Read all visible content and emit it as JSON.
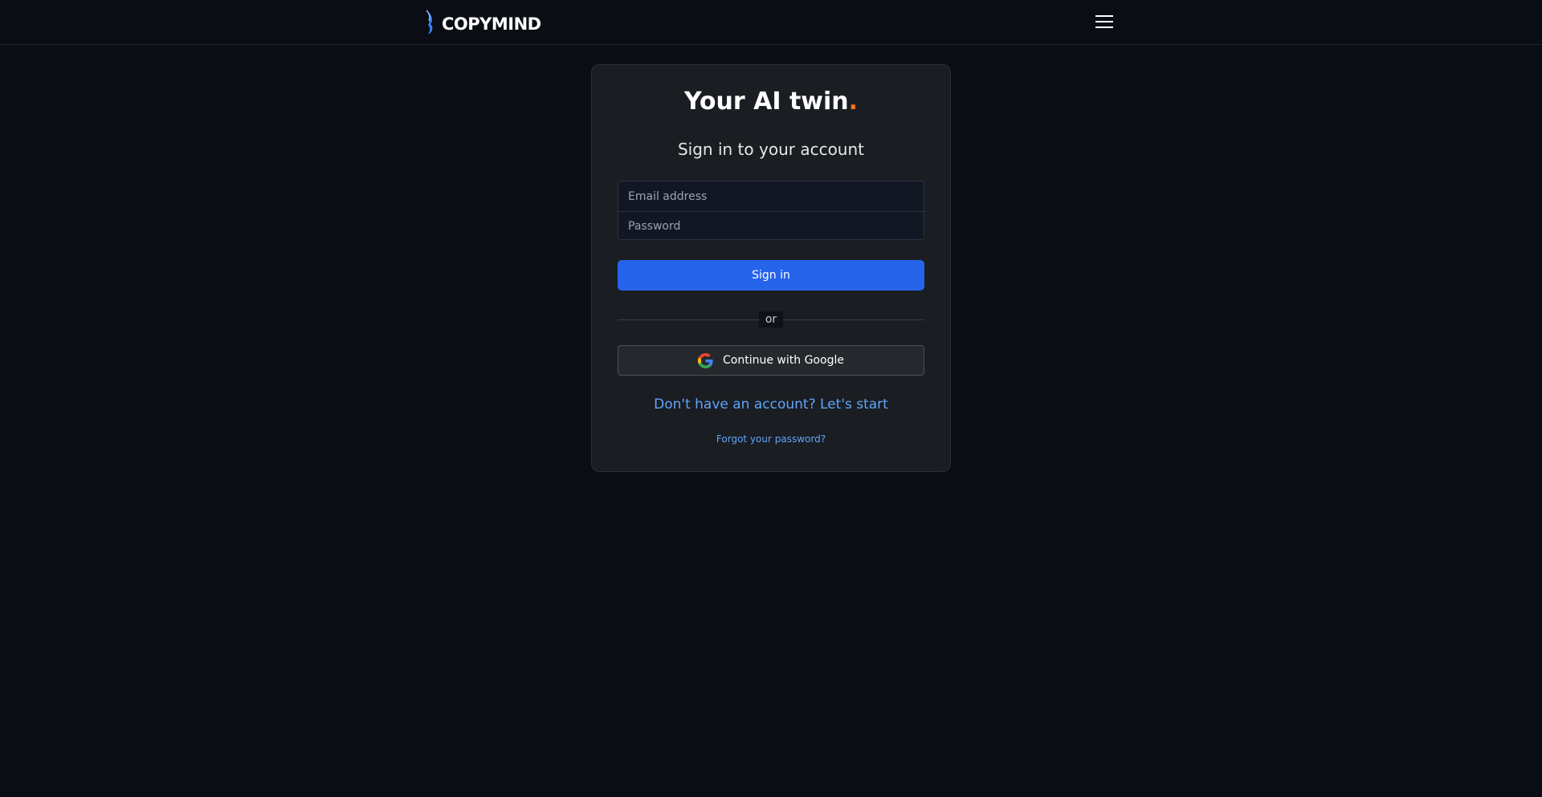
{
  "header": {
    "brand_name": "COPYMIND",
    "brand_icon": "copymind-logo-icon",
    "menu_icon": "hamburger-menu-icon"
  },
  "card": {
    "title": "Your AI twin",
    "title_dot": ".",
    "subtitle": "Sign in to your account",
    "email_placeholder": "Email address",
    "email_value": "",
    "password_placeholder": "Password",
    "password_value": "",
    "signin_label": "Sign in",
    "divider_text": "or",
    "google_label": "Continue with Google",
    "google_icon": "google-icon",
    "signup_link": "Don't have an account? Let's start",
    "forgot_link": "Forgot your password?"
  },
  "colors": {
    "background": "#0a0d14",
    "card": "#1a1d22",
    "accent": "#2563eb",
    "link": "#60a5fa",
    "title_dot": "#f97316"
  }
}
